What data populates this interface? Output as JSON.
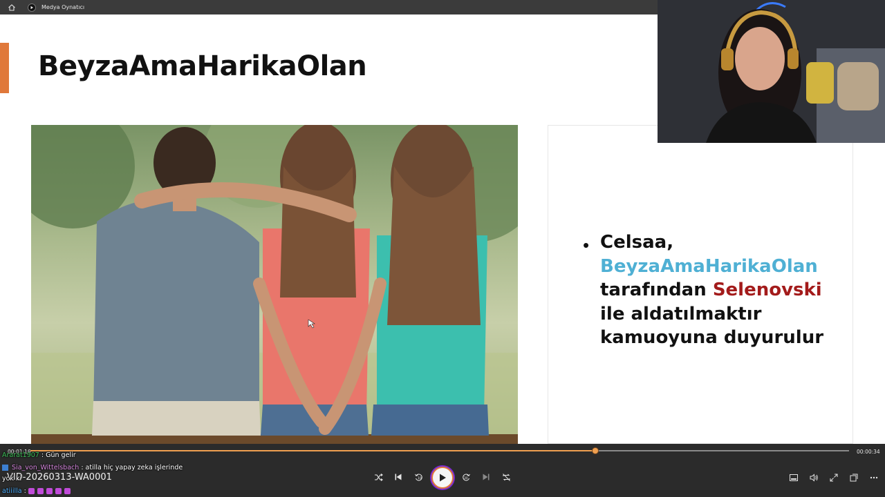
{
  "window": {
    "title": "Medya Oynatıcı"
  },
  "slide": {
    "title": "BeyzaAmaHarikaOlan",
    "bullet": {
      "part1": "Celsaa,",
      "name_blue": "BeyzaAmaHarikaOlan",
      "part2": "tarafından",
      "name_red": "Selenovski",
      "part3": "ile aldatılmaktır",
      "part4": "kamuoyuna duyurulur"
    },
    "colors": {
      "accent": "#e0783a",
      "highlight_blue": "#4fb0d4",
      "highlight_red": "#a31b1b"
    }
  },
  "player": {
    "current_time": "00:01:16",
    "remaining_time": "00:00:34",
    "progress_fraction": 0.69,
    "media_name": "VID-20260313-WA0001",
    "controls": [
      "shuffle-icon",
      "previous-icon",
      "rewind-10-icon",
      "play-icon",
      "forward-30-icon",
      "next-icon",
      "repeat-off-icon"
    ],
    "right_controls": [
      "miniplayer-icon",
      "volume-icon",
      "expand-icon",
      "fullscreen-icon",
      "more-icon"
    ],
    "colors": {
      "accent": "#f0a050",
      "play_ring": "#e07a3a"
    }
  },
  "chat": {
    "messages": [
      {
        "user": "Ararat1907",
        "separator": ":",
        "text": "Gün gelir",
        "user_color": "#3fc15a"
      },
      {
        "user": "Sia_von_Wittelsbach",
        "separator": ":",
        "text": "atilla hiç yapay zeka işlerinde",
        "user_color": "#d889e0"
      },
      {
        "user": "",
        "separator": "",
        "text": "yok ki",
        "user_color": "#ffffff"
      },
      {
        "user": "atiiilla",
        "separator": ":",
        "text": "",
        "user_color": "#4fb0ff"
      }
    ]
  }
}
